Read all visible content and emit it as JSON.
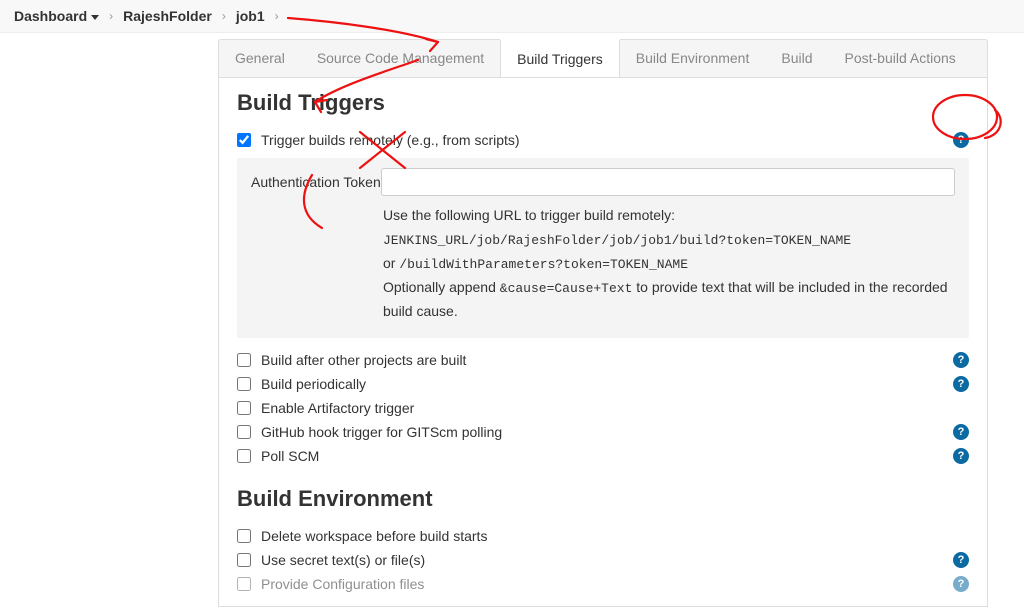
{
  "breadcrumb": {
    "segments": [
      "Dashboard",
      "RajeshFolder",
      "job1"
    ]
  },
  "tabs": [
    {
      "label": "General"
    },
    {
      "label": "Source Code Management"
    },
    {
      "label": "Build Triggers"
    },
    {
      "label": "Build Environment"
    },
    {
      "label": "Build"
    },
    {
      "label": "Post-build Actions"
    }
  ],
  "activeTab": "Build Triggers",
  "section1": {
    "title": "Build Triggers",
    "trigger_remote_label": "Trigger builds remotely (e.g., from scripts)",
    "auth_token_label": "Authentication Token",
    "auth_token_value": "",
    "help_line1_pre": "Use the following URL to trigger build remotely: ",
    "help_line1_code": "JENKINS_URL/job/RajeshFolder/job/job1/build?token=TOKEN_NAME",
    "help_line2_pre": "or ",
    "help_line2_code": "/buildWithParameters?token=TOKEN_NAME",
    "help_line3_pre": "Optionally append ",
    "help_line3_code": "&cause=Cause+Text",
    "help_line3_post": " to provide text that will be included in the recorded build cause.",
    "opts": [
      {
        "label": "Build after other projects are built",
        "help": true
      },
      {
        "label": "Build periodically",
        "help": true
      },
      {
        "label": "Enable Artifactory trigger",
        "help": false
      },
      {
        "label": "GitHub hook trigger for GITScm polling",
        "help": true
      },
      {
        "label": "Poll SCM",
        "help": true
      }
    ]
  },
  "section2": {
    "title": "Build Environment",
    "opts": [
      {
        "label": "Delete workspace before build starts",
        "help": false
      },
      {
        "label": "Use secret text(s) or file(s)",
        "help": true
      },
      {
        "label": "Provide Configuration files",
        "help": true
      }
    ]
  },
  "annotations": {
    "color": "#e11"
  }
}
